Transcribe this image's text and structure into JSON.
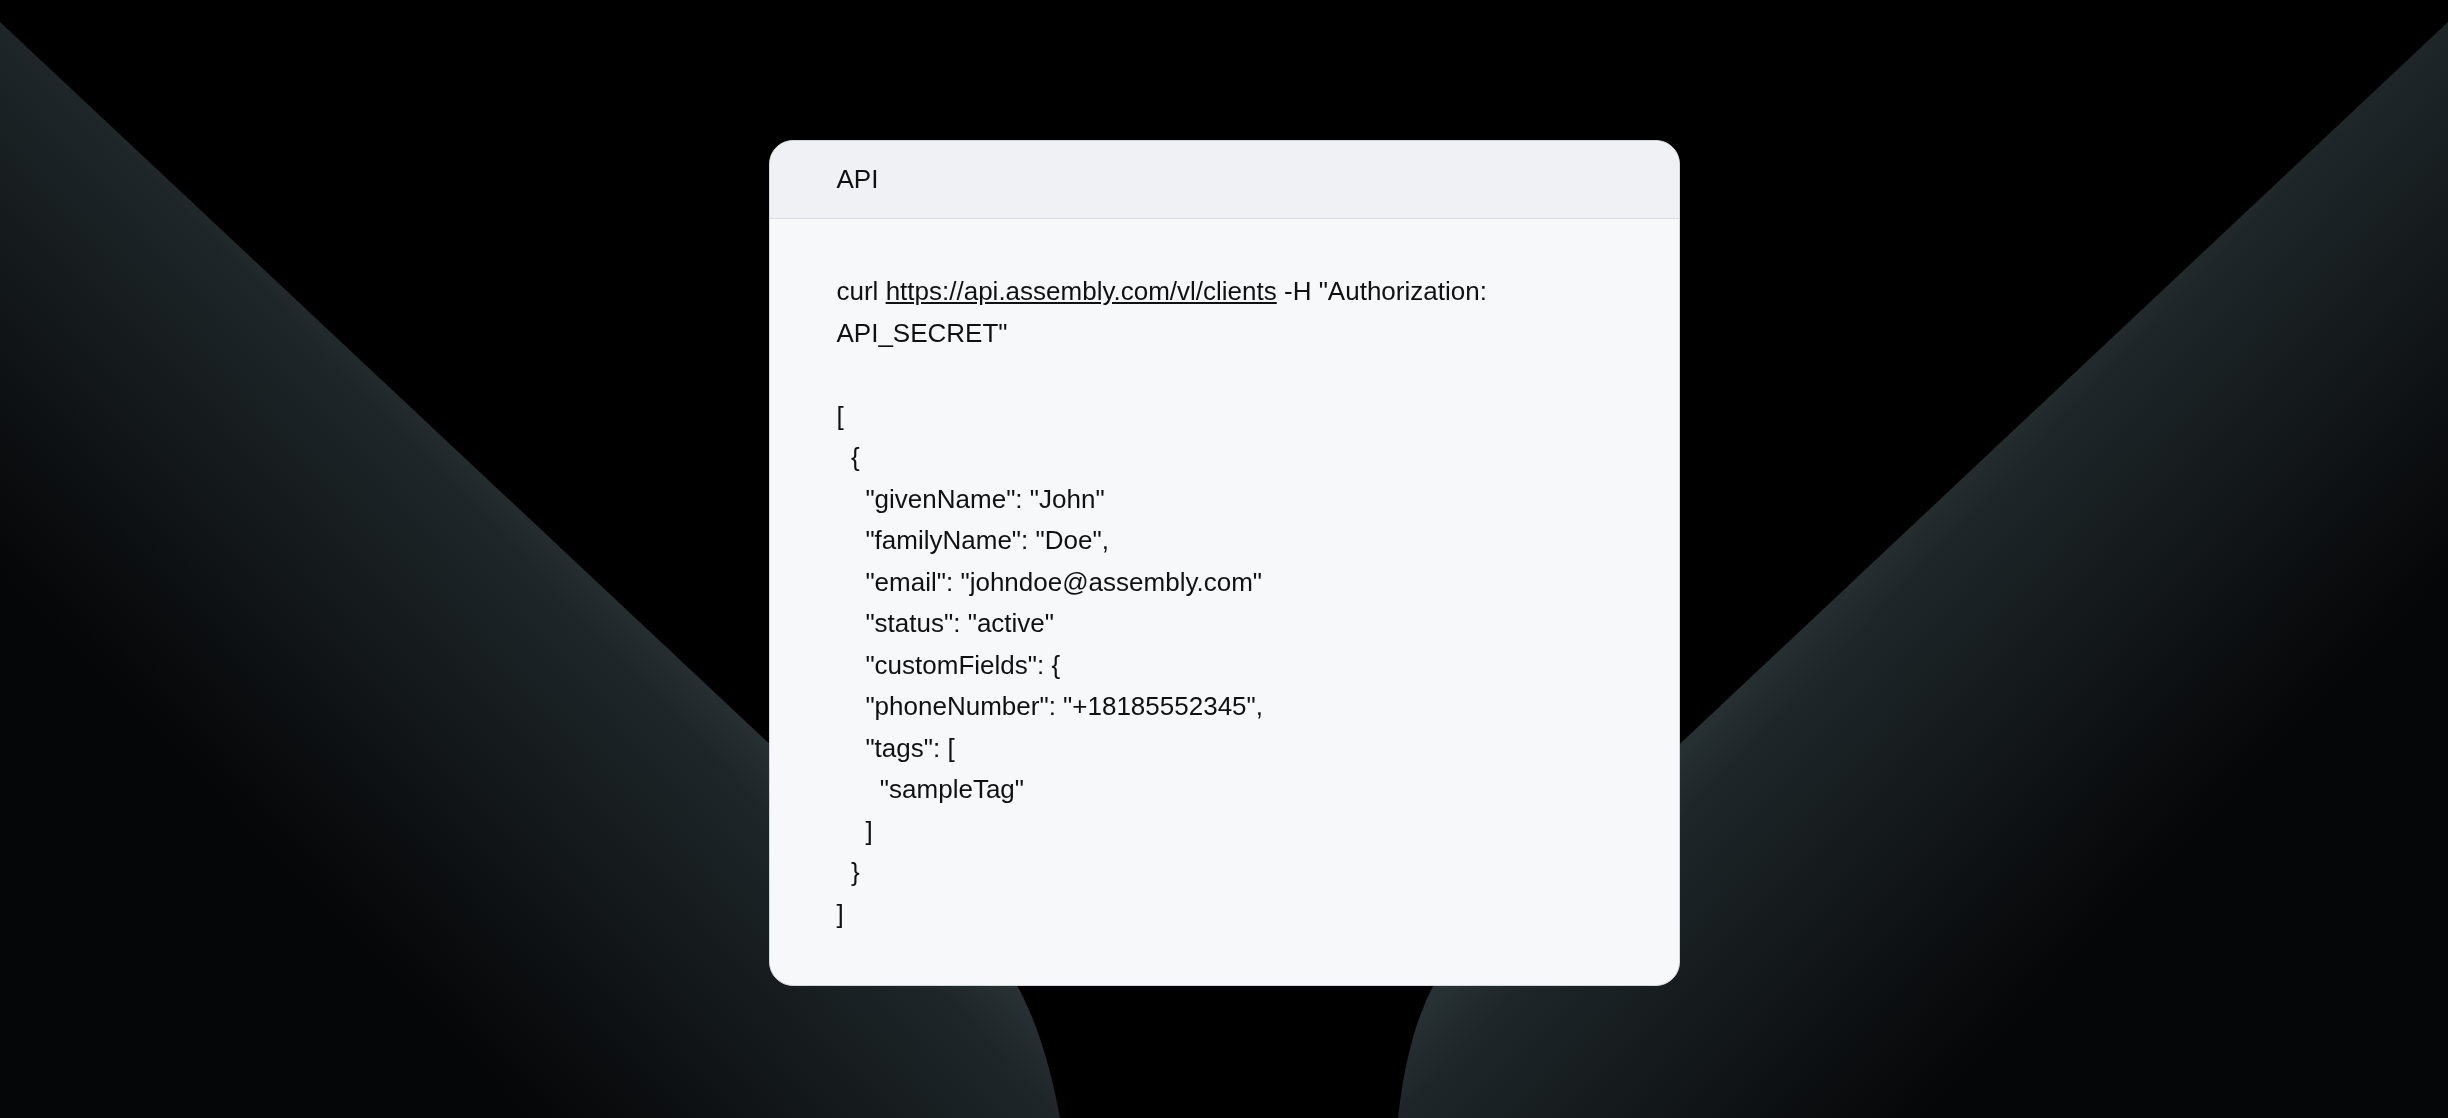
{
  "card": {
    "title": "API",
    "command": {
      "before": "curl",
      "link": "https://api.assembly.com/vl/clients",
      "after": "-H \"Authorization: API_SECRET\""
    },
    "response_lines": [
      "[",
      "  {",
      "    \"givenName\": \"John\"",
      "    \"familyName\": \"Doe\",",
      "    \"email\": \"johndoe@assembly.com\"",
      "    \"status\": \"active\"",
      "    \"customFields\": {",
      "    \"phoneNumber\": \"+18185552345\",",
      "    \"tags\": [",
      "      \"sampleTag\"",
      "    ]",
      "  }",
      "]"
    ]
  }
}
